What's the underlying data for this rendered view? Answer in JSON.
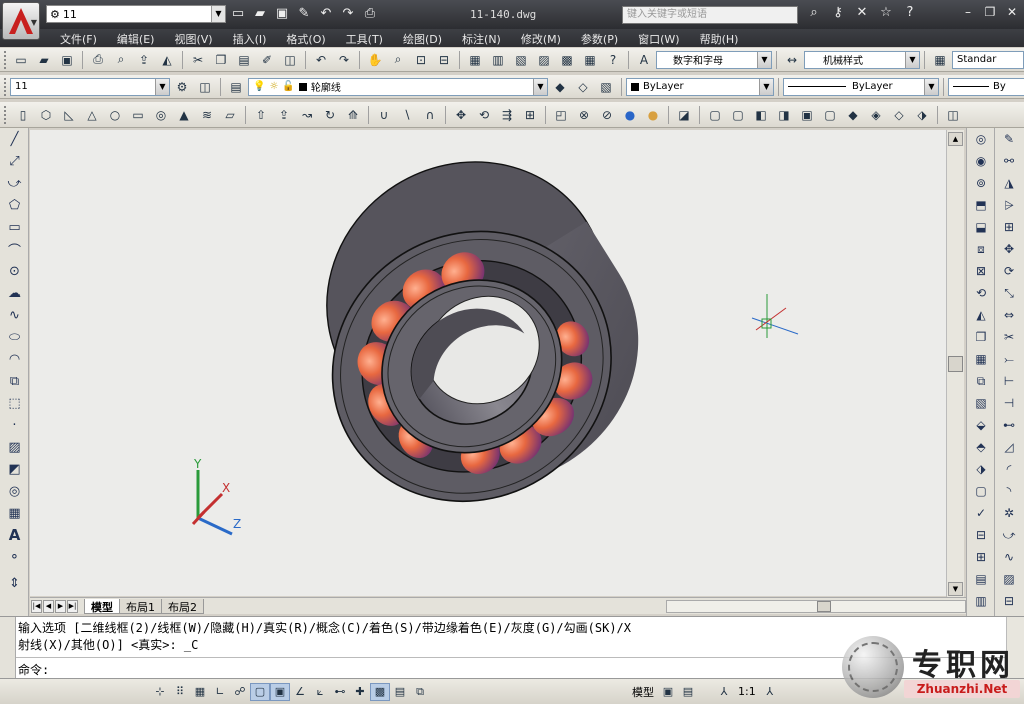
{
  "titlebar": {
    "workspace": "11",
    "document": "11-140.dwg",
    "search_placeholder": "键入关键字或短语"
  },
  "menu": [
    "文件(F)",
    "编辑(E)",
    "视图(V)",
    "插入(I)",
    "格式(O)",
    "工具(T)",
    "绘图(D)",
    "标注(N)",
    "修改(M)",
    "参数(P)",
    "窗口(W)",
    "帮助(H)"
  ],
  "styles_toolbar": {
    "text_style": "数字和字母",
    "dim_style": "机械样式",
    "table_style": "Standar"
  },
  "layers_toolbar": {
    "view_combo": "11",
    "layer": "轮廓线",
    "color": "ByLayer",
    "linetype": "ByLayer",
    "lineweight": "By"
  },
  "layout_tabs": [
    "模型",
    "布局1",
    "布局2"
  ],
  "ucs": {
    "y": "Y",
    "x": "X",
    "z": "Z"
  },
  "command": {
    "line1": "输入选项 [二维线框(2)/线框(W)/隐藏(H)/真实(R)/概念(C)/着色(S)/带边缘着色(E)/灰度(G)/勾画(SK)/X",
    "line2": "射线(X)/其他(O)] <真实>: _C",
    "prompt": "命令:"
  },
  "status": {
    "space": "模型",
    "scale": "1:1"
  },
  "watermark": {
    "cn": "专职网",
    "en": "Zhuanzhi.Net"
  },
  "colors": {
    "accent": "#c8201e",
    "model_gray": "#5a5860",
    "ball_orange": "#e07048"
  }
}
